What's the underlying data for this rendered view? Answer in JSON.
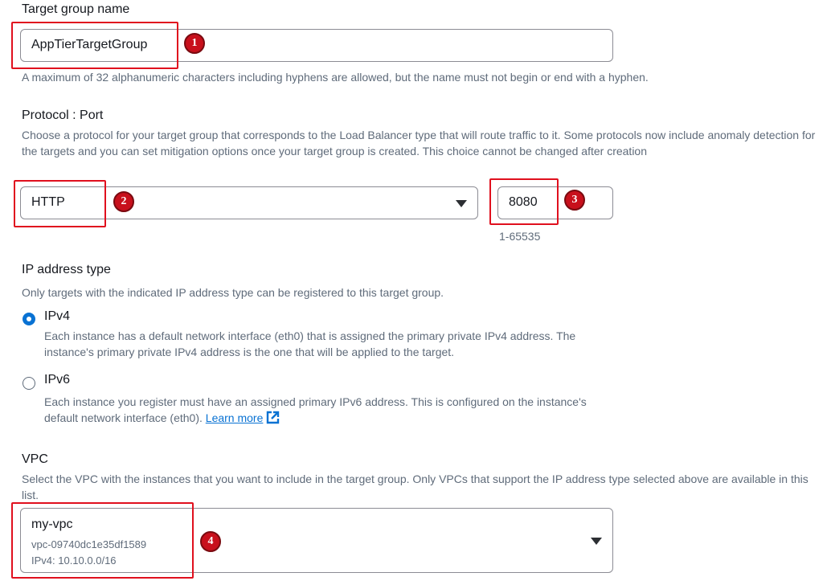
{
  "target_group": {
    "label": "Target group name",
    "value": "AppTierTargetGroup",
    "hint": "A maximum of 32 alphanumeric characters including hyphens are allowed, but the name must not begin or end with a hyphen."
  },
  "protocol_port": {
    "label": "Protocol : Port",
    "description": "Choose a protocol for your target group that corresponds to the Load Balancer type that will route traffic to it. Some protocols now include anomaly detection for the targets and you can set mitigation options once your target group is created. This choice cannot be changed after creation",
    "protocol_value": "HTTP",
    "port_value": "8080",
    "port_hint": "1-65535"
  },
  "ip_address_type": {
    "label": "IP address type",
    "description": "Only targets with the indicated IP address type can be registered to this target group.",
    "options": [
      {
        "label": "IPv4",
        "selected": true,
        "description": "Each instance has a default network interface (eth0) that is assigned the primary private IPv4 address. The instance's primary private IPv4 address is the one that will be applied to the target."
      },
      {
        "label": "IPv6",
        "selected": false,
        "description": "Each instance you register must have an assigned primary IPv6 address. This is configured on the instance's default network interface (eth0).",
        "link": "Learn more"
      }
    ]
  },
  "vpc": {
    "label": "VPC",
    "description": "Select the VPC with the instances that you want to include in the target group. Only VPCs that support the IP address type selected above are available in this list.",
    "name": "my-vpc",
    "id": "vpc-09740dc1e35df1589",
    "cidr": "IPv4: 10.10.0.0/16"
  },
  "annotations": [
    "1",
    "2",
    "3",
    "4"
  ],
  "colors": {
    "annotation": "#e0101e",
    "badge": "#c8101c",
    "radio_selected": "#0972d3",
    "link": "#0972d3"
  }
}
